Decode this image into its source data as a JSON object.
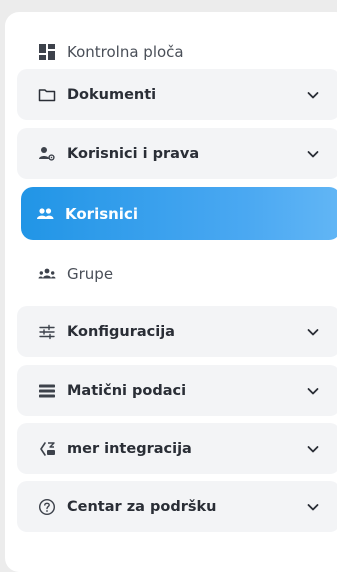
{
  "menu": {
    "dashboard": {
      "label": "Kontrolna ploča",
      "icon": "dashboard-icon"
    },
    "documents": {
      "label": "Dokumenti",
      "icon": "folder-icon",
      "expandable": true
    },
    "users_rights": {
      "label": "Korisnici i prava",
      "icon": "user-settings-icon",
      "expandable": true
    },
    "users": {
      "label": "Korisnici",
      "icon": "users-icon",
      "active": true
    },
    "groups": {
      "label": "Grupe",
      "icon": "groups-icon"
    },
    "configuration": {
      "label": "Konfiguracija",
      "icon": "sliders-icon",
      "expandable": true
    },
    "master_data": {
      "label": "Matični podaci",
      "icon": "list-icon",
      "expandable": true
    },
    "mer_integration": {
      "label": "mer integracija",
      "icon": "integration-icon",
      "expandable": true
    },
    "support": {
      "label": "Centar za podršku",
      "icon": "help-icon",
      "expandable": true
    }
  },
  "colors": {
    "active_gradient_start": "#2195e6",
    "active_gradient_end": "#62b6f5",
    "group_background": "#f3f4f6",
    "text": "#2a2e36"
  }
}
